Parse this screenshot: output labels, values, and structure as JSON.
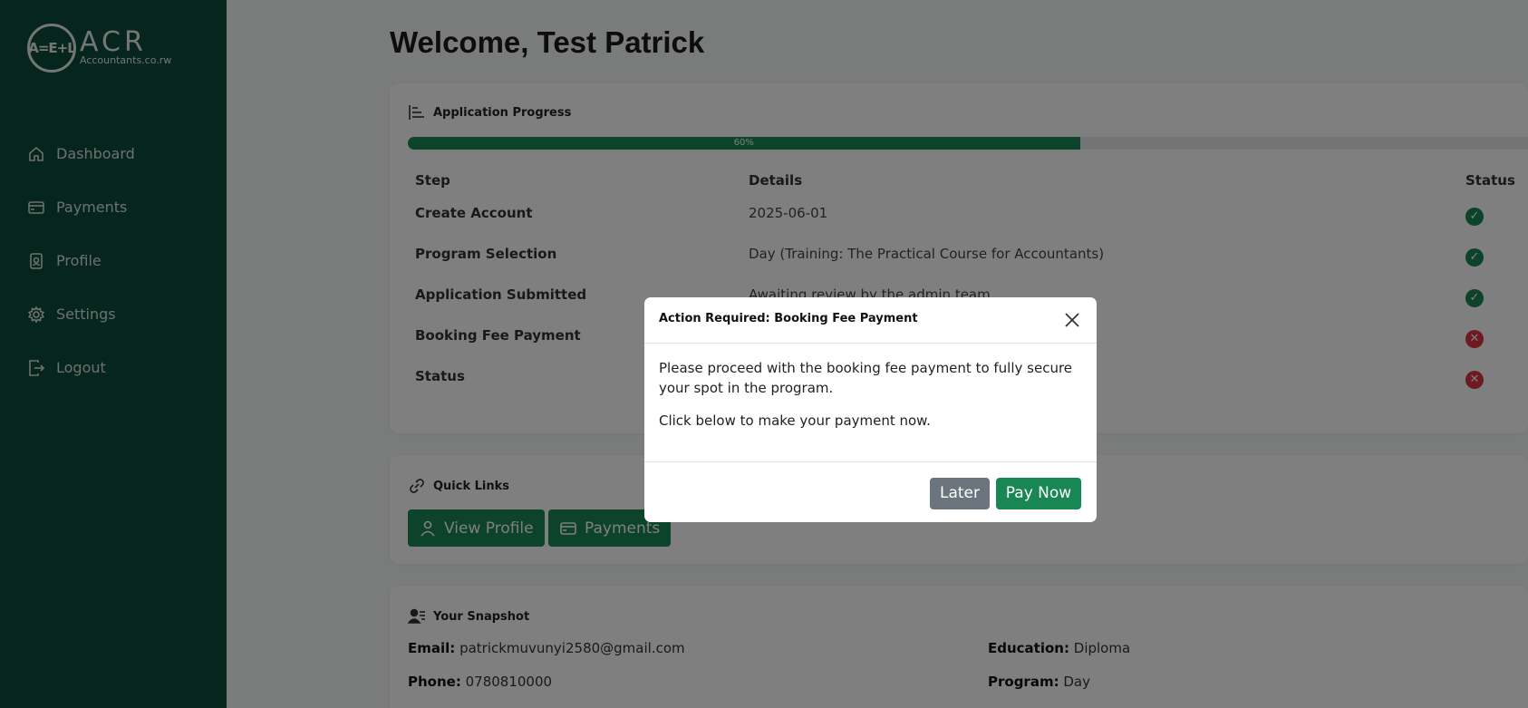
{
  "logo": {
    "mark": "A=E+L",
    "name": "ACR",
    "sub": "Accountants.co.rw"
  },
  "nav": [
    {
      "label": "Dashboard",
      "icon": "home-icon"
    },
    {
      "label": "Payments",
      "icon": "credit-card-icon"
    },
    {
      "label": "Profile",
      "icon": "badge-icon"
    },
    {
      "label": "Settings",
      "icon": "gear-icon"
    },
    {
      "label": "Logout",
      "icon": "logout-icon"
    }
  ],
  "welcome": "Welcome, Test Patrick",
  "progress": {
    "title": "Application Progress",
    "percent": 60,
    "percent_label": "60%",
    "headers": {
      "step": "Step",
      "details": "Details",
      "status": "Status"
    },
    "rows": [
      {
        "step": "Create Account",
        "details": "2025-06-01",
        "status": "done"
      },
      {
        "step": "Program Selection",
        "details": "Day (Training: The Practical Course for Accountants)",
        "status": "done"
      },
      {
        "step": "Application Submitted",
        "details": "Awaiting review by the admin team",
        "status": "done"
      },
      {
        "step": "Booking Fee Payment",
        "details": "",
        "status": "pending"
      },
      {
        "step": "Status",
        "details": "",
        "status": "pending"
      }
    ]
  },
  "quick_links": {
    "title": "Quick Links",
    "view_profile": "View Profile",
    "payments": "Payments"
  },
  "snapshot": {
    "title": "Your Snapshot",
    "email_label": "Email:",
    "email": "patrickmuvunyi2580@gmail.com",
    "phone_label": "Phone:",
    "phone": "0780810000",
    "education_label": "Education:",
    "education": "Diploma",
    "program_label": "Program:",
    "program": "Day"
  },
  "modal": {
    "title": "Action Required: Booking Fee Payment",
    "body1": "Please proceed with the booking fee payment to fully secure your spot in the program.",
    "body2": "Click below to make your payment now.",
    "later": "Later",
    "pay_now": "Pay Now"
  },
  "colors": {
    "sidebar": "#0b4a3b",
    "accent": "#198754",
    "danger": "#dc3545",
    "secondary": "#6c757d"
  }
}
